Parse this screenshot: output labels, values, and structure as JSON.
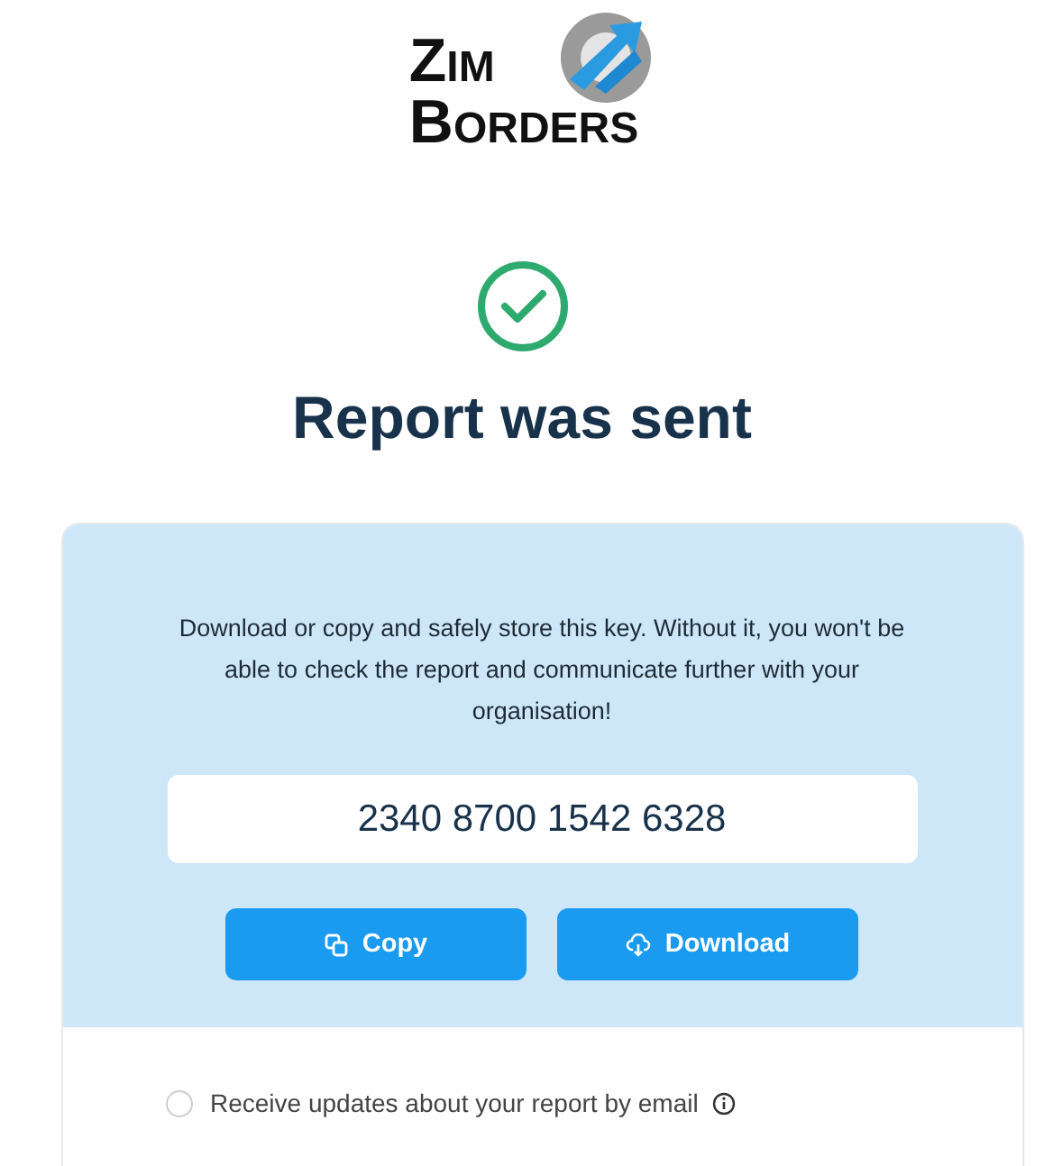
{
  "logo": {
    "lines": [
      "ZIM",
      "BORDERS"
    ]
  },
  "status": {
    "kind": "success",
    "title": "Report was sent"
  },
  "key_panel": {
    "message": "Download or copy and safely store this key. Without it, you won't be able to check the report and communicate further with your organisation!",
    "key": "2340 8700 1542 6328",
    "buttons": [
      {
        "kind": "copy",
        "label": "Copy"
      },
      {
        "kind": "download",
        "label": "Download"
      }
    ]
  },
  "email_updates": {
    "label": "Receive updates about your report by email",
    "checked": false
  }
}
